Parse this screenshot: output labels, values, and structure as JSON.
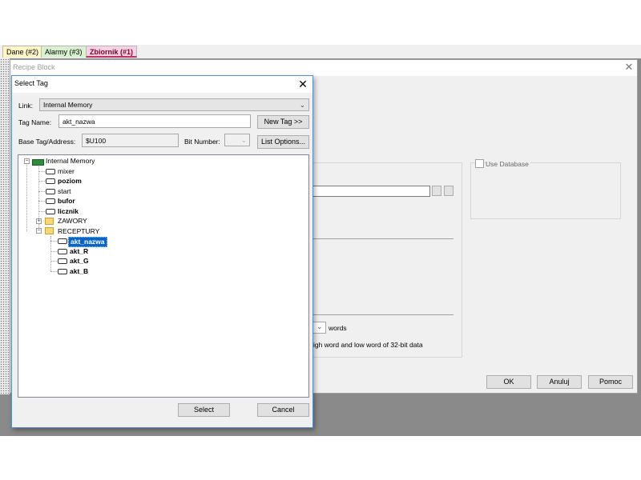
{
  "tabs": [
    {
      "label": "Dane (#2)",
      "color": "#fff6c8"
    },
    {
      "label": "Alarmy (#3)",
      "color": "#d8f2d0"
    },
    {
      "label": "Zbiornik (#1)",
      "color": "#f6d2e6"
    }
  ],
  "recipe_block": {
    "title": "Recipe Block",
    "use_database_label": "Use Database",
    "words_label": "words",
    "high_low_text": "igh word and low word of 32-bit data",
    "ok_label": "OK",
    "cancel_label": "Anuluj",
    "help_label": "Pomoc"
  },
  "select_tag": {
    "title": "Select Tag",
    "link_label": "Link:",
    "link_value": "Internal Memory",
    "tag_name_label": "Tag Name:",
    "tag_name_value": "akt_nazwa",
    "new_tag_label": "New Tag >>",
    "base_tag_label": "Base Tag/Address:",
    "base_tag_value": "$U100",
    "bit_number_label": "Bit Number:",
    "list_options_label": "List Options...",
    "select_label": "Select",
    "cancel_label": "Cancel",
    "tree": {
      "root": "Internal Memory",
      "items": [
        "mixer",
        "poziom",
        "start",
        "bufor",
        "licznik"
      ],
      "folders": [
        "ZAWORY",
        "RECEPTURY"
      ],
      "recept_items": [
        "akt_nazwa",
        "akt_R",
        "akt_G",
        "akt_B"
      ]
    }
  },
  "colors": {
    "selection": "#0a64c8",
    "workspace": "#8a8a8a"
  }
}
